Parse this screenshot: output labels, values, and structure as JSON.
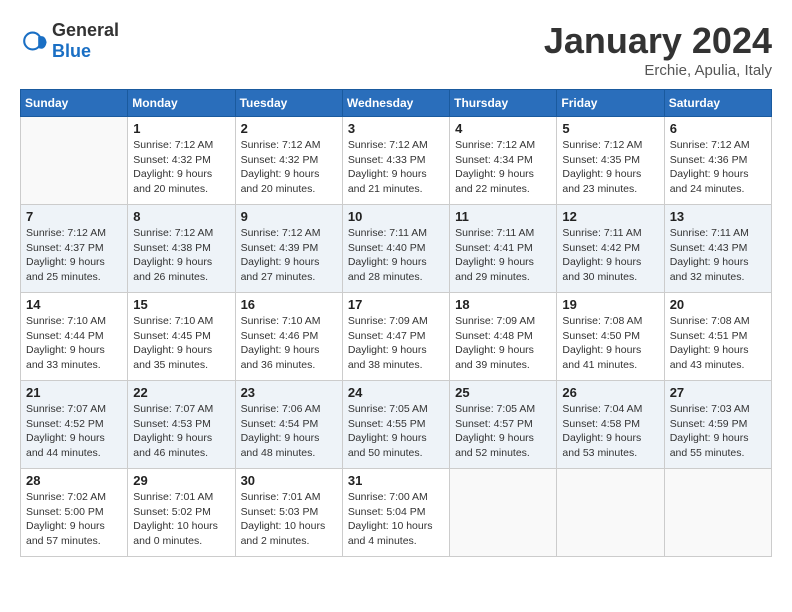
{
  "header": {
    "logo_general": "General",
    "logo_blue": "Blue",
    "month_year": "January 2024",
    "location": "Erchie, Apulia, Italy"
  },
  "weekdays": [
    "Sunday",
    "Monday",
    "Tuesday",
    "Wednesday",
    "Thursday",
    "Friday",
    "Saturday"
  ],
  "weeks": [
    [
      {
        "day": "",
        "sunrise": "",
        "sunset": "",
        "daylight": ""
      },
      {
        "day": "1",
        "sunrise": "Sunrise: 7:12 AM",
        "sunset": "Sunset: 4:32 PM",
        "daylight": "Daylight: 9 hours and 20 minutes."
      },
      {
        "day": "2",
        "sunrise": "Sunrise: 7:12 AM",
        "sunset": "Sunset: 4:32 PM",
        "daylight": "Daylight: 9 hours and 20 minutes."
      },
      {
        "day": "3",
        "sunrise": "Sunrise: 7:12 AM",
        "sunset": "Sunset: 4:33 PM",
        "daylight": "Daylight: 9 hours and 21 minutes."
      },
      {
        "day": "4",
        "sunrise": "Sunrise: 7:12 AM",
        "sunset": "Sunset: 4:34 PM",
        "daylight": "Daylight: 9 hours and 22 minutes."
      },
      {
        "day": "5",
        "sunrise": "Sunrise: 7:12 AM",
        "sunset": "Sunset: 4:35 PM",
        "daylight": "Daylight: 9 hours and 23 minutes."
      },
      {
        "day": "6",
        "sunrise": "Sunrise: 7:12 AM",
        "sunset": "Sunset: 4:36 PM",
        "daylight": "Daylight: 9 hours and 24 minutes."
      }
    ],
    [
      {
        "day": "7",
        "sunrise": "Sunrise: 7:12 AM",
        "sunset": "Sunset: 4:37 PM",
        "daylight": "Daylight: 9 hours and 25 minutes."
      },
      {
        "day": "8",
        "sunrise": "Sunrise: 7:12 AM",
        "sunset": "Sunset: 4:38 PM",
        "daylight": "Daylight: 9 hours and 26 minutes."
      },
      {
        "day": "9",
        "sunrise": "Sunrise: 7:12 AM",
        "sunset": "Sunset: 4:39 PM",
        "daylight": "Daylight: 9 hours and 27 minutes."
      },
      {
        "day": "10",
        "sunrise": "Sunrise: 7:11 AM",
        "sunset": "Sunset: 4:40 PM",
        "daylight": "Daylight: 9 hours and 28 minutes."
      },
      {
        "day": "11",
        "sunrise": "Sunrise: 7:11 AM",
        "sunset": "Sunset: 4:41 PM",
        "daylight": "Daylight: 9 hours and 29 minutes."
      },
      {
        "day": "12",
        "sunrise": "Sunrise: 7:11 AM",
        "sunset": "Sunset: 4:42 PM",
        "daylight": "Daylight: 9 hours and 30 minutes."
      },
      {
        "day": "13",
        "sunrise": "Sunrise: 7:11 AM",
        "sunset": "Sunset: 4:43 PM",
        "daylight": "Daylight: 9 hours and 32 minutes."
      }
    ],
    [
      {
        "day": "14",
        "sunrise": "Sunrise: 7:10 AM",
        "sunset": "Sunset: 4:44 PM",
        "daylight": "Daylight: 9 hours and 33 minutes."
      },
      {
        "day": "15",
        "sunrise": "Sunrise: 7:10 AM",
        "sunset": "Sunset: 4:45 PM",
        "daylight": "Daylight: 9 hours and 35 minutes."
      },
      {
        "day": "16",
        "sunrise": "Sunrise: 7:10 AM",
        "sunset": "Sunset: 4:46 PM",
        "daylight": "Daylight: 9 hours and 36 minutes."
      },
      {
        "day": "17",
        "sunrise": "Sunrise: 7:09 AM",
        "sunset": "Sunset: 4:47 PM",
        "daylight": "Daylight: 9 hours and 38 minutes."
      },
      {
        "day": "18",
        "sunrise": "Sunrise: 7:09 AM",
        "sunset": "Sunset: 4:48 PM",
        "daylight": "Daylight: 9 hours and 39 minutes."
      },
      {
        "day": "19",
        "sunrise": "Sunrise: 7:08 AM",
        "sunset": "Sunset: 4:50 PM",
        "daylight": "Daylight: 9 hours and 41 minutes."
      },
      {
        "day": "20",
        "sunrise": "Sunrise: 7:08 AM",
        "sunset": "Sunset: 4:51 PM",
        "daylight": "Daylight: 9 hours and 43 minutes."
      }
    ],
    [
      {
        "day": "21",
        "sunrise": "Sunrise: 7:07 AM",
        "sunset": "Sunset: 4:52 PM",
        "daylight": "Daylight: 9 hours and 44 minutes."
      },
      {
        "day": "22",
        "sunrise": "Sunrise: 7:07 AM",
        "sunset": "Sunset: 4:53 PM",
        "daylight": "Daylight: 9 hours and 46 minutes."
      },
      {
        "day": "23",
        "sunrise": "Sunrise: 7:06 AM",
        "sunset": "Sunset: 4:54 PM",
        "daylight": "Daylight: 9 hours and 48 minutes."
      },
      {
        "day": "24",
        "sunrise": "Sunrise: 7:05 AM",
        "sunset": "Sunset: 4:55 PM",
        "daylight": "Daylight: 9 hours and 50 minutes."
      },
      {
        "day": "25",
        "sunrise": "Sunrise: 7:05 AM",
        "sunset": "Sunset: 4:57 PM",
        "daylight": "Daylight: 9 hours and 52 minutes."
      },
      {
        "day": "26",
        "sunrise": "Sunrise: 7:04 AM",
        "sunset": "Sunset: 4:58 PM",
        "daylight": "Daylight: 9 hours and 53 minutes."
      },
      {
        "day": "27",
        "sunrise": "Sunrise: 7:03 AM",
        "sunset": "Sunset: 4:59 PM",
        "daylight": "Daylight: 9 hours and 55 minutes."
      }
    ],
    [
      {
        "day": "28",
        "sunrise": "Sunrise: 7:02 AM",
        "sunset": "Sunset: 5:00 PM",
        "daylight": "Daylight: 9 hours and 57 minutes."
      },
      {
        "day": "29",
        "sunrise": "Sunrise: 7:01 AM",
        "sunset": "Sunset: 5:02 PM",
        "daylight": "Daylight: 10 hours and 0 minutes."
      },
      {
        "day": "30",
        "sunrise": "Sunrise: 7:01 AM",
        "sunset": "Sunset: 5:03 PM",
        "daylight": "Daylight: 10 hours and 2 minutes."
      },
      {
        "day": "31",
        "sunrise": "Sunrise: 7:00 AM",
        "sunset": "Sunset: 5:04 PM",
        "daylight": "Daylight: 10 hours and 4 minutes."
      },
      {
        "day": "",
        "sunrise": "",
        "sunset": "",
        "daylight": ""
      },
      {
        "day": "",
        "sunrise": "",
        "sunset": "",
        "daylight": ""
      },
      {
        "day": "",
        "sunrise": "",
        "sunset": "",
        "daylight": ""
      }
    ]
  ]
}
